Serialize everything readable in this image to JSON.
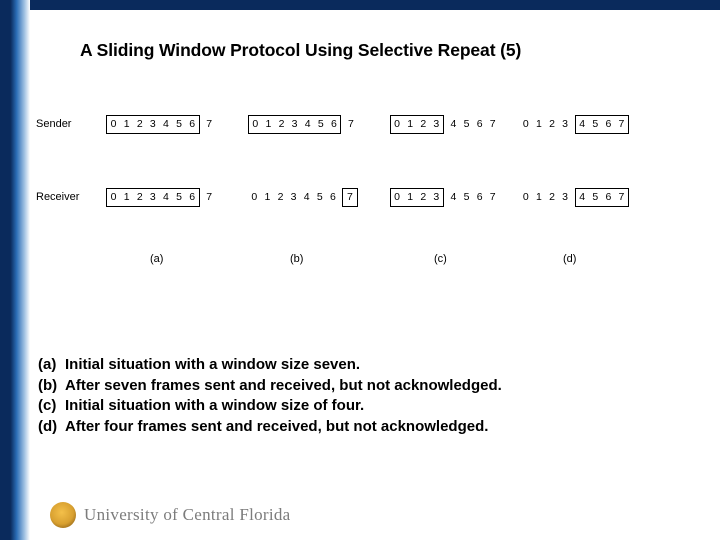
{
  "title": "A Sliding Window Protocol Using Selective Repeat (5)",
  "labels": {
    "sender": "Sender",
    "receiver": "Receiver"
  },
  "windows": {
    "a": {
      "sender": {
        "in": [
          "0",
          "1",
          "2",
          "3",
          "4",
          "5",
          "6"
        ],
        "out_right": [
          "7"
        ]
      },
      "receiver": {
        "in": [
          "0",
          "1",
          "2",
          "3",
          "4",
          "5",
          "6"
        ],
        "out_right": [
          "7"
        ]
      }
    },
    "b": {
      "sender": {
        "in": [
          "0",
          "1",
          "2",
          "3",
          "4",
          "5",
          "6"
        ],
        "out_right": [
          "7"
        ]
      },
      "receiver": {
        "out_left": [
          "0",
          "1",
          "2",
          "3",
          "4",
          "5",
          "6"
        ],
        "in": [
          "7"
        ]
      }
    },
    "c": {
      "sender": {
        "in": [
          "0",
          "1",
          "2",
          "3"
        ],
        "out_right": [
          "4",
          "5",
          "6",
          "7"
        ]
      },
      "receiver": {
        "in": [
          "0",
          "1",
          "2",
          "3"
        ],
        "out_right": [
          "4",
          "5",
          "6",
          "7"
        ]
      }
    },
    "d": {
      "sender": {
        "out_left": [
          "0",
          "1",
          "2",
          "3"
        ],
        "in": [
          "4",
          "5",
          "6",
          "7"
        ]
      },
      "receiver": {
        "out_left": [
          "0",
          "1",
          "2",
          "3"
        ],
        "in": [
          "4",
          "5",
          "6",
          "7"
        ]
      }
    }
  },
  "sublabels": {
    "a": "(a)",
    "b": "(b)",
    "c": "(c)",
    "d": "(d)"
  },
  "descriptions": {
    "a": {
      "key": "(a)",
      "text": "Initial situation with a window size seven."
    },
    "b": {
      "key": "(b)",
      "text": "After seven frames sent and received, but not acknowledged."
    },
    "c": {
      "key": "(c)",
      "text": "Initial situation with a window size of four."
    },
    "d": {
      "key": "(d)",
      "text": "After four frames sent and received, but not acknowledged."
    }
  },
  "footer": {
    "university": "University of Central Florida"
  }
}
